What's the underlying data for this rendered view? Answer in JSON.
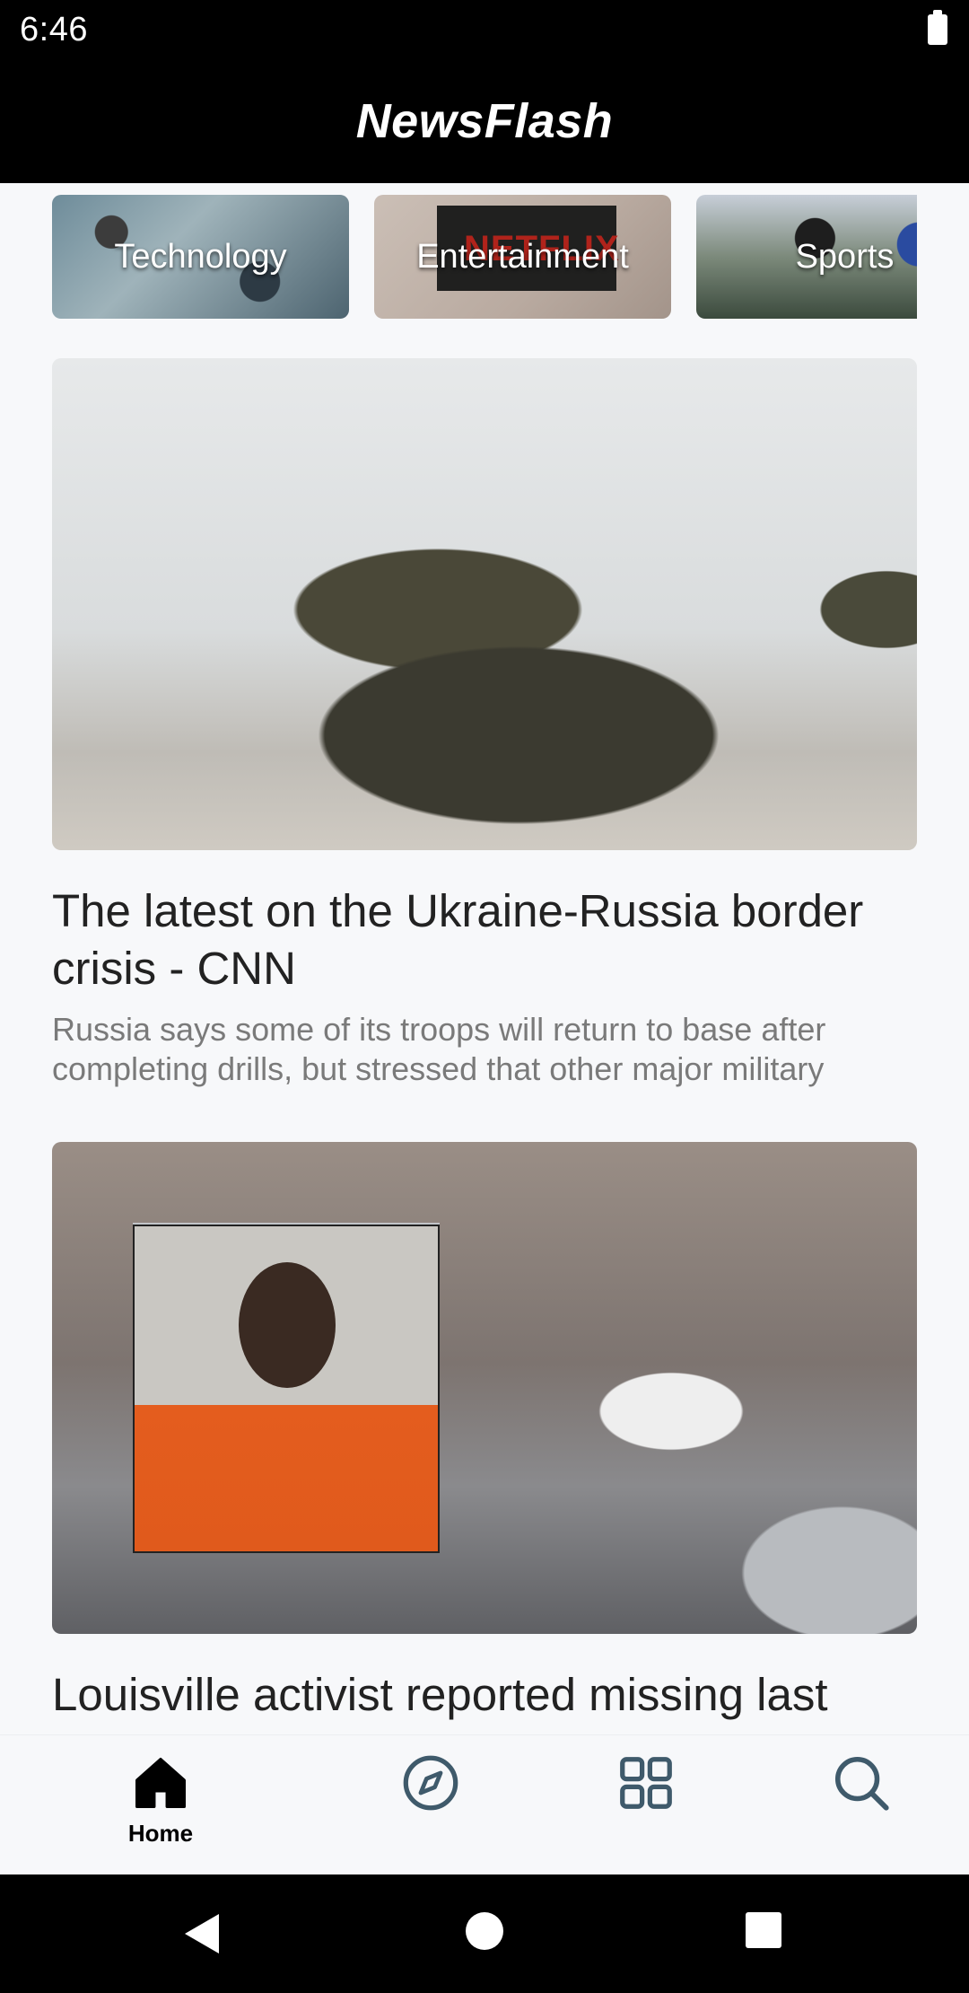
{
  "status_bar": {
    "time": "6:46"
  },
  "app_bar": {
    "title": "NewsFlash"
  },
  "categories": [
    {
      "label": "Technology"
    },
    {
      "label": "Entertainment",
      "image_text": "NETFLIX"
    },
    {
      "label": "Sports"
    }
  ],
  "articles": [
    {
      "title": "The latest on the Ukraine-Russia border crisis - CNN",
      "description": "Russia says some of its troops will return to base after completing drills, but stressed that other major military"
    },
    {
      "title": "Louisville activist reported missing last"
    }
  ],
  "bottom_nav": {
    "items": [
      {
        "label": "Home",
        "icon": "home-icon",
        "active": true
      },
      {
        "label": "",
        "icon": "compass-icon",
        "active": false
      },
      {
        "label": "",
        "icon": "grid-icon",
        "active": false
      },
      {
        "label": "",
        "icon": "search-icon",
        "active": false
      }
    ]
  },
  "colors": {
    "app_bar": "#000000",
    "background": "#f7f8fa",
    "nav_icon_inactive": "#3f5a6b",
    "title_text": "#222222",
    "description_text": "#7a7a7a"
  }
}
